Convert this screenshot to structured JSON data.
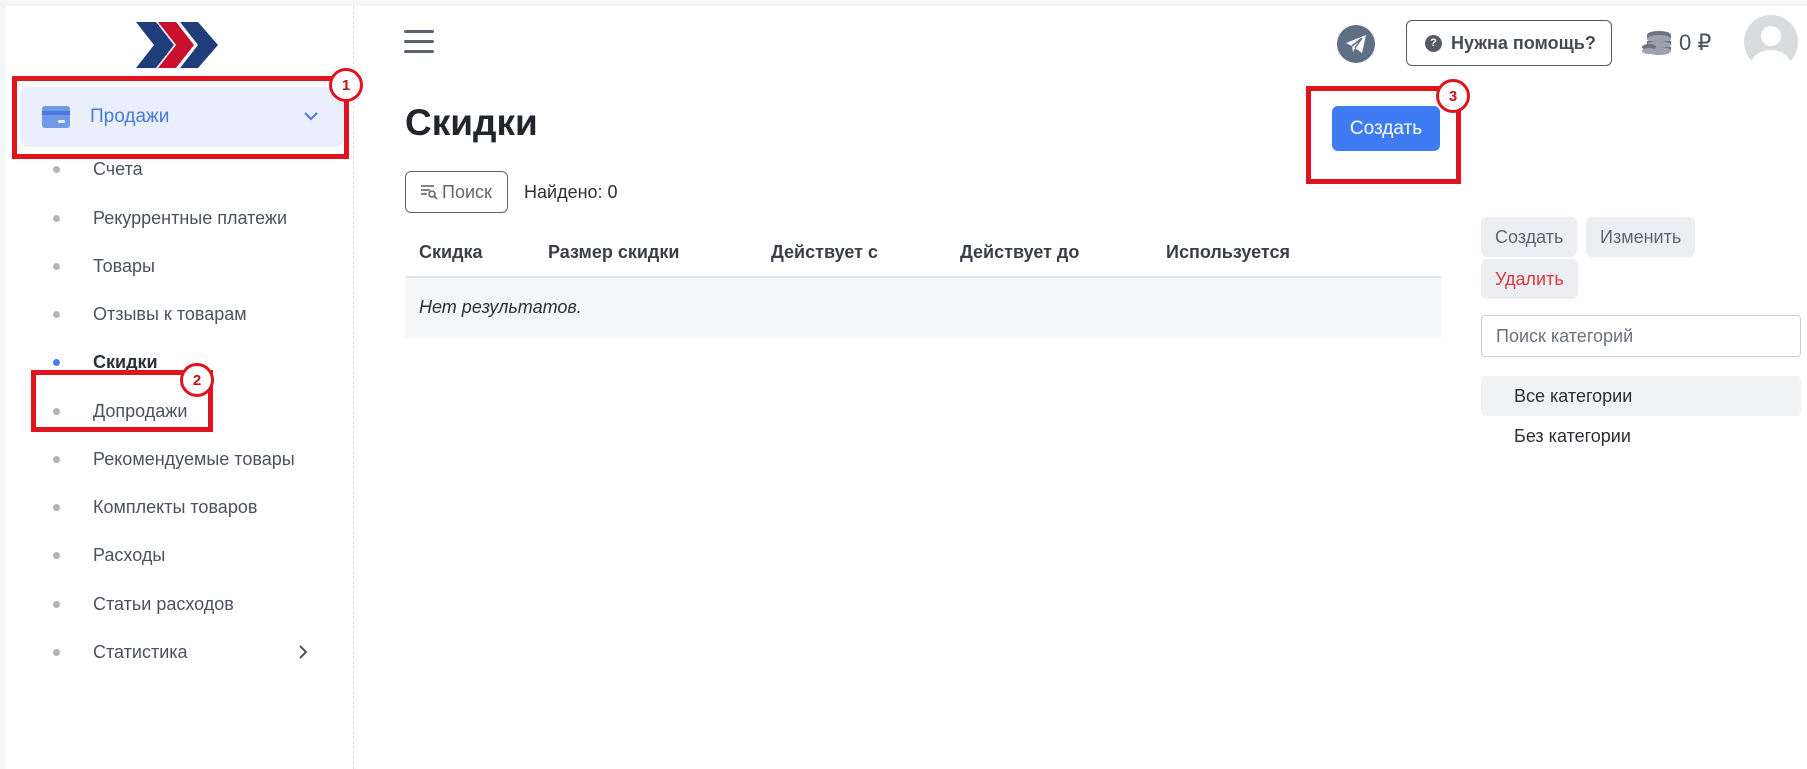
{
  "sidebar": {
    "section": {
      "label": "Продажи"
    },
    "items": [
      {
        "label": "Счета"
      },
      {
        "label": "Рекуррентные платежи"
      },
      {
        "label": "Товары"
      },
      {
        "label": "Отзывы к товарам"
      },
      {
        "label": "Скидки",
        "active": true
      },
      {
        "label": "Допродажи"
      },
      {
        "label": "Рекомендуемые товары"
      },
      {
        "label": "Комплекты товаров"
      },
      {
        "label": "Расходы"
      },
      {
        "label": "Статьи расходов"
      },
      {
        "label": "Статистика"
      }
    ]
  },
  "header": {
    "help_label": "Нужна помощь?",
    "help_icon_glyph": "?",
    "balance": "0 ₽"
  },
  "main": {
    "title": "Скидки",
    "create_label": "Создать",
    "search_label": "Поиск",
    "found_label": "Найдено: 0",
    "table": {
      "columns": [
        "Скидка",
        "Размер скидки",
        "Действует с",
        "Действует до",
        "Используется"
      ],
      "empty_text": "Нет результатов."
    }
  },
  "categories": {
    "create_label": "Создать",
    "edit_label": "Изменить",
    "delete_label": "Удалить",
    "search_placeholder": "Поиск категорий",
    "items": [
      {
        "label": "Все категории",
        "selected": true
      },
      {
        "label": "Без категории"
      }
    ]
  },
  "annotations": [
    "1",
    "2",
    "3"
  ],
  "colors": {
    "accent": "#3f7cf4",
    "nav_active_bg": "#e9effc",
    "nav_active_text": "#4a78dd",
    "danger": "#d9363e",
    "annotation": "#e0141c",
    "logo_red": "#c8102e",
    "logo_navy": "#1f3d7a"
  }
}
